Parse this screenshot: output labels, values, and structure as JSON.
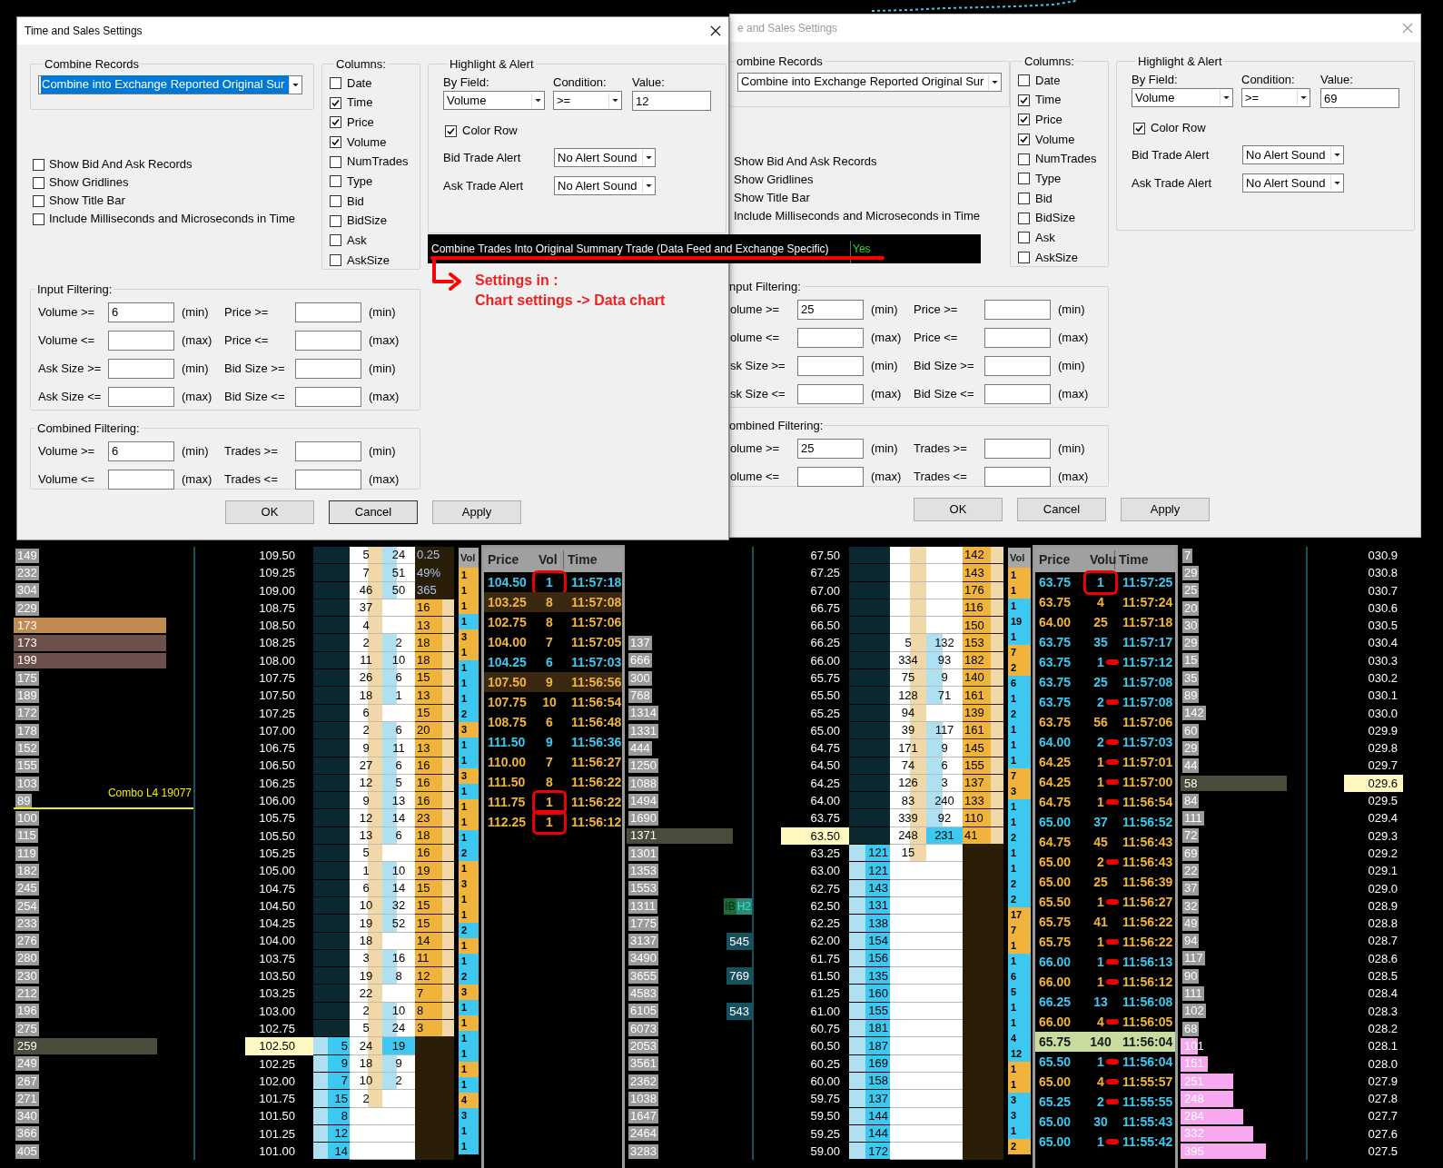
{
  "dialogs": [
    {
      "title": "Time and Sales Settings",
      "active": true,
      "combine_records": {
        "label": "Combine Records",
        "value": "Combine into Exchange Reported Original Sur",
        "focused": true
      },
      "options": [
        {
          "label": "Show Bid And Ask Records",
          "checked": false
        },
        {
          "label": "Show Gridlines",
          "checked": false
        },
        {
          "label": "Show Title Bar",
          "checked": false
        },
        {
          "label": "Include Milliseconds and Microseconds in Time",
          "checked": false
        }
      ],
      "columns": {
        "label": "Columns:",
        "items": [
          {
            "label": "Date",
            "checked": false
          },
          {
            "label": "Time",
            "checked": true
          },
          {
            "label": "Price",
            "checked": true
          },
          {
            "label": "Volume",
            "checked": true
          },
          {
            "label": "NumTrades",
            "checked": false
          },
          {
            "label": "Type",
            "checked": false
          },
          {
            "label": "Bid",
            "checked": false
          },
          {
            "label": "BidSize",
            "checked": false
          },
          {
            "label": "Ask",
            "checked": false
          },
          {
            "label": "AskSize",
            "checked": false
          }
        ]
      },
      "highlight": {
        "label": "Highlight & Alert",
        "by_field_label": "By Field:",
        "by_field": "Volume",
        "condition_label": "Condition:",
        "condition": ">=",
        "value_label": "Value:",
        "value": "12",
        "color_row": {
          "label": "Color Row",
          "checked": true
        },
        "bid_alert_label": "Bid Trade Alert",
        "bid_alert": "No Alert Sound",
        "ask_alert_label": "Ask Trade Alert",
        "ask_alert": "No Alert Sound"
      },
      "input_filtering": {
        "label": "Input Filtering:",
        "rows": [
          [
            {
              "label": "Volume >=",
              "value": "6",
              "unit": "(min)"
            },
            {
              "label": "Price >=",
              "unit": "(min)"
            }
          ],
          [
            {
              "label": "Volume <=",
              "unit": "(max)"
            },
            {
              "label": "Price <=",
              "unit": "(max)"
            }
          ],
          [
            {
              "label": "Ask Size >=",
              "unit": "(min)"
            },
            {
              "label": "Bid Size >=",
              "unit": "(min)"
            }
          ],
          [
            {
              "label": "Ask Size <=",
              "unit": "(max)"
            },
            {
              "label": "Bid Size <=",
              "unit": "(max)"
            }
          ]
        ]
      },
      "combined_filtering": {
        "label": "Combined Filtering:",
        "rows": [
          [
            {
              "label": "Volume >=",
              "value": "6",
              "unit": "(min)"
            },
            {
              "label": "Trades >=",
              "unit": "(min)"
            }
          ],
          [
            {
              "label": "Volume <=",
              "unit": "(max)"
            },
            {
              "label": "Trades <=",
              "unit": "(max)"
            }
          ]
        ]
      },
      "buttons": [
        "OK",
        "Cancel",
        "Apply"
      ]
    },
    {
      "title": "e and Sales Settings",
      "active": false,
      "combine_records": {
        "label": "ombine Records",
        "value": "Combine into Exchange Reported Original Sur",
        "focused": false
      },
      "options": [
        {
          "label": "Show Bid And Ask Records"
        },
        {
          "label": "Show Gridlines"
        },
        {
          "label": "Show Title Bar"
        },
        {
          "label": "Include Milliseconds and Microseconds in Time"
        }
      ],
      "columns": {
        "label": "Columns:",
        "items": [
          {
            "label": "Date",
            "checked": false
          },
          {
            "label": "Time",
            "checked": true
          },
          {
            "label": "Price",
            "checked": true
          },
          {
            "label": "Volume",
            "checked": true
          },
          {
            "label": "NumTrades",
            "checked": false
          },
          {
            "label": "Type",
            "checked": false
          },
          {
            "label": "Bid",
            "checked": false
          },
          {
            "label": "BidSize",
            "checked": false
          },
          {
            "label": "Ask",
            "checked": false
          },
          {
            "label": "AskSize",
            "checked": false
          }
        ]
      },
      "highlight": {
        "label": "Highlight & Alert",
        "by_field_label": "By Field:",
        "by_field": "Volume",
        "condition_label": "Condition:",
        "condition": ">=",
        "value_label": "Value:",
        "value": "69",
        "color_row": {
          "label": "Color Row",
          "checked": true
        },
        "bid_alert_label": "Bid Trade Alert",
        "bid_alert": "No Alert Sound",
        "ask_alert_label": "Ask Trade Alert",
        "ask_alert": "No Alert Sound"
      },
      "input_filtering": {
        "label": "nput Filtering:",
        "rows": [
          [
            {
              "label": "olume >=",
              "value": "25",
              "unit": "(min)"
            },
            {
              "label": "Price >=",
              "unit": "(min)"
            }
          ],
          [
            {
              "label": "olume <=",
              "unit": "(max)"
            },
            {
              "label": "Price <=",
              "unit": "(max)"
            }
          ],
          [
            {
              "label": "sk Size >=",
              "unit": "(min)"
            },
            {
              "label": "Bid Size >=",
              "unit": "(min)"
            }
          ],
          [
            {
              "label": "sk Size <=",
              "unit": "(max)"
            },
            {
              "label": "Bid Size <=",
              "unit": "(max)"
            }
          ]
        ]
      },
      "combined_filtering": {
        "label": "ombined Filtering:",
        "rows": [
          [
            {
              "label": "olume >=",
              "value": "25",
              "unit": "(min)"
            },
            {
              "label": "Trades >=",
              "unit": "(min)"
            }
          ],
          [
            {
              "label": "olume <=",
              "unit": "(max)"
            },
            {
              "label": "Trades <=",
              "unit": "(max)"
            }
          ]
        ]
      },
      "buttons": [
        "OK",
        "Cancel",
        "Apply"
      ]
    }
  ],
  "annotation": {
    "setting": "Combine Trades Into Original Summary Trade (Data Feed and Exchange Specific)",
    "setting_value": "Yes",
    "note": [
      "Settings in :",
      "Chart settings -> Data chart"
    ]
  },
  "ladders": [
    {
      "rows": [
        {
          "profile": "149",
          "price": "109.50",
          "c1": "5",
          "c2": "24",
          "c3": "0.25",
          "kind": "summary"
        },
        {
          "profile": "232",
          "price": "109.25",
          "c1": "7",
          "c2": "51",
          "c3": "49%",
          "kind": "summary"
        },
        {
          "profile": "304",
          "price": "109.00",
          "c1": "46",
          "c2": "50",
          "c3": "365",
          "kind": "summary"
        },
        {
          "profile": "229",
          "price": "108.75",
          "c1": "37",
          "c3": "16",
          "kind": "ask"
        },
        {
          "profile": "173",
          "price": "108.50",
          "c1": "4",
          "c3": "13",
          "kind": "ask",
          "color": "#c08a50",
          "level": 0.85
        },
        {
          "profile": "173",
          "price": "108.25",
          "c1": "2",
          "c2": "2",
          "c3": "18",
          "kind": "ask",
          "color": "#6c504c",
          "level": 0.85
        },
        {
          "profile": "199",
          "price": "108.00",
          "c1": "11",
          "c2": "10",
          "c3": "18",
          "kind": "ask",
          "color": "#6c504c",
          "level": 0.85
        },
        {
          "profile": "175",
          "price": "107.75",
          "c1": "26",
          "c2": "6",
          "c3": "15",
          "kind": "ask"
        },
        {
          "profile": "189",
          "price": "107.50",
          "c1": "18",
          "c2": "1",
          "c3": "13",
          "kind": "ask"
        },
        {
          "profile": "172",
          "price": "107.25",
          "c1": "6",
          "c3": "15",
          "kind": "ask"
        },
        {
          "profile": "178",
          "price": "107.00",
          "c1": "2",
          "c2": "6",
          "c3": "20",
          "kind": "ask"
        },
        {
          "profile": "152",
          "price": "106.75",
          "c1": "9",
          "c2": "11",
          "c3": "13",
          "kind": "ask"
        },
        {
          "profile": "155",
          "price": "106.50",
          "c1": "27",
          "c2": "6",
          "c3": "16",
          "kind": "ask"
        },
        {
          "profile": "103",
          "price": "106.25",
          "c1": "12",
          "c2": "5",
          "c3": "16",
          "kind": "ask"
        },
        {
          "profile": "89",
          "price": "106.00",
          "c1": "9",
          "c2": "13",
          "c3": "16",
          "kind": "ask",
          "line": "Combo L4 19077"
        },
        {
          "profile": "100",
          "price": "105.75",
          "c1": "12",
          "c2": "14",
          "c3": "23",
          "kind": "ask"
        },
        {
          "profile": "115",
          "price": "105.50",
          "c1": "13",
          "c2": "6",
          "c3": "18",
          "kind": "ask"
        },
        {
          "profile": "119",
          "price": "105.25",
          "c1": "5",
          "c3": "16",
          "kind": "ask"
        },
        {
          "profile": "182",
          "price": "105.00",
          "c1": "1",
          "c2": "10",
          "c3": "19",
          "kind": "ask"
        },
        {
          "profile": "245",
          "price": "104.75",
          "c1": "6",
          "c2": "14",
          "c3": "15",
          "kind": "ask"
        },
        {
          "profile": "254",
          "price": "104.50",
          "c1": "10",
          "c2": "32",
          "c3": "15",
          "kind": "ask"
        },
        {
          "profile": "233",
          "price": "104.25",
          "c1": "19",
          "c2": "52",
          "c3": "15",
          "kind": "ask"
        },
        {
          "profile": "276",
          "price": "104.00",
          "c1": "18",
          "c3": "14",
          "kind": "ask"
        },
        {
          "profile": "280",
          "price": "103.75",
          "c1": "3",
          "c2": "16",
          "c3": "11",
          "kind": "ask"
        },
        {
          "profile": "230",
          "price": "103.50",
          "c1": "19",
          "c2": "8",
          "c3": "12",
          "kind": "ask"
        },
        {
          "profile": "212",
          "price": "103.25",
          "c1": "22",
          "c3": "7",
          "kind": "ask"
        },
        {
          "profile": "196",
          "price": "103.00",
          "c1": "2",
          "c2": "10",
          "c3": "8",
          "kind": "ask"
        },
        {
          "profile": "275",
          "price": "102.75",
          "c1": "5",
          "c2": "24",
          "c3": "3",
          "kind": "ask"
        },
        {
          "profile": "259",
          "price": "102.50",
          "bid": "5",
          "c1": "24",
          "c2": "19",
          "kind": "last",
          "color": "#4c4c3c",
          "level": 0.8
        },
        {
          "profile": "249",
          "price": "102.25",
          "bid": "9",
          "c1": "18",
          "c2": "9",
          "kind": "bid"
        },
        {
          "profile": "267",
          "price": "102.00",
          "bid": "7",
          "c1": "10",
          "c2": "2",
          "kind": "bid"
        },
        {
          "profile": "271",
          "price": "101.75",
          "bid": "15",
          "c1": "2",
          "kind": "bid"
        },
        {
          "profile": "340",
          "price": "101.50",
          "bid": "8",
          "kind": "bid"
        },
        {
          "profile": "366",
          "price": "101.25",
          "bid": "12",
          "kind": "bid"
        },
        {
          "profile": "405",
          "price": "101.00",
          "bid": "14",
          "kind": "bid"
        }
      ]
    },
    {
      "rows": [
        {
          "price": "67.50",
          "c3": "142",
          "kind": "ask"
        },
        {
          "price": "67.25",
          "c3": "143",
          "kind": "ask"
        },
        {
          "price": "67.00",
          "c3": "176",
          "kind": "ask"
        },
        {
          "price": "66.75",
          "c3": "116",
          "kind": "ask"
        },
        {
          "price": "66.50",
          "c3": "150",
          "kind": "ask"
        },
        {
          "profile": "137",
          "price": "66.25",
          "c1": "5",
          "c2": "132",
          "c3": "153",
          "kind": "ask"
        },
        {
          "profile": "666",
          "price": "66.00",
          "c1": "334",
          "c2": "93",
          "c3": "182",
          "kind": "ask"
        },
        {
          "profile": "300",
          "price": "65.75",
          "c1": "75",
          "c2": "9",
          "c3": "140",
          "kind": "ask"
        },
        {
          "profile": "768",
          "price": "65.50",
          "c1": "128",
          "c2": "71",
          "c3": "161",
          "kind": "ask"
        },
        {
          "profile": "1314",
          "price": "65.25",
          "c1": "94",
          "c3": "139",
          "kind": "ask"
        },
        {
          "profile": "1331",
          "price": "65.00",
          "c1": "39",
          "c2": "117",
          "c3": "161",
          "kind": "ask"
        },
        {
          "profile": "444",
          "price": "64.75",
          "c1": "171",
          "c2": "9",
          "c3": "145",
          "kind": "ask"
        },
        {
          "profile": "1250",
          "price": "64.50",
          "c1": "74",
          "c2": "6",
          "c3": "155",
          "kind": "ask"
        },
        {
          "profile": "1088",
          "price": "64.25",
          "c1": "126",
          "c2": "3",
          "c3": "137",
          "kind": "ask"
        },
        {
          "profile": "1494",
          "price": "64.00",
          "c1": "83",
          "c2": "240",
          "c3": "133",
          "kind": "ask"
        },
        {
          "profile": "1690",
          "price": "63.75",
          "c1": "339",
          "c2": "92",
          "c3": "110",
          "kind": "ask"
        },
        {
          "profile": "1371",
          "price": "63.50",
          "c1": "248",
          "c2": "231",
          "c3": "41",
          "kind": "last",
          "color": "#4c4c3c",
          "level": 0.85
        },
        {
          "profile": "1301",
          "price": "63.25",
          "bid": "121",
          "c1": "15",
          "kind": "bid"
        },
        {
          "profile": "1353",
          "price": "63.00",
          "bid": "121",
          "kind": "bid"
        },
        {
          "profile": "1553",
          "price": "62.75",
          "bid": "143",
          "kind": "bid"
        },
        {
          "profile": "1311",
          "price": "62.50",
          "bid": "131",
          "kind": "bid",
          "tags": [
            "IB",
            "H2"
          ]
        },
        {
          "profile": "1775",
          "price": "62.25",
          "bid": "138",
          "kind": "bid"
        },
        {
          "profile": "3137",
          "price": "62.00",
          "bid": "154",
          "kind": "bid",
          "hist": "545"
        },
        {
          "profile": "3490",
          "price": "61.75",
          "bid": "156",
          "kind": "bid"
        },
        {
          "profile": "3655",
          "price": "61.50",
          "bid": "135",
          "kind": "bid",
          "hist": "769"
        },
        {
          "profile": "4583",
          "price": "61.25",
          "bid": "160",
          "kind": "bid"
        },
        {
          "profile": "6105",
          "price": "61.00",
          "bid": "155",
          "kind": "bid",
          "hist": "543"
        },
        {
          "profile": "6073",
          "price": "60.75",
          "bid": "181",
          "kind": "bid"
        },
        {
          "profile": "2053",
          "price": "60.50",
          "bid": "187",
          "kind": "bid"
        },
        {
          "profile": "3561",
          "price": "60.25",
          "bid": "169",
          "kind": "bid"
        },
        {
          "profile": "2362",
          "price": "60.00",
          "bid": "158",
          "kind": "bid"
        },
        {
          "profile": "1038",
          "price": "59.75",
          "bid": "137",
          "kind": "bid"
        },
        {
          "profile": "1647",
          "price": "59.50",
          "bid": "144",
          "kind": "bid"
        },
        {
          "profile": "2464",
          "price": "59.25",
          "bid": "144",
          "kind": "bid"
        },
        {
          "profile": "3283",
          "price": "59.00",
          "bid": "172",
          "kind": "bid"
        }
      ]
    },
    {
      "rows": [
        {
          "profile": "7",
          "price": "030.9",
          "kind": "ask"
        },
        {
          "profile": "29",
          "price": "030.8",
          "kind": "ask"
        },
        {
          "profile": "25",
          "price": "030.7",
          "kind": "ask"
        },
        {
          "profile": "20",
          "price": "030.6",
          "kind": "ask"
        },
        {
          "profile": "30",
          "price": "030.5",
          "kind": "ask"
        },
        {
          "profile": "29",
          "price": "030.4",
          "kind": "ask"
        },
        {
          "profile": "15",
          "price": "030.3",
          "kind": "ask"
        },
        {
          "profile": "35",
          "price": "030.2",
          "kind": "ask"
        },
        {
          "profile": "89",
          "price": "030.1",
          "kind": "ask"
        },
        {
          "profile": "142",
          "price": "030.0",
          "kind": "ask"
        },
        {
          "profile": "60",
          "price": "029.9",
          "kind": "ask"
        },
        {
          "profile": "29",
          "price": "029.8",
          "kind": "ask"
        },
        {
          "profile": "44",
          "price": "029.7",
          "kind": "ask"
        },
        {
          "profile": "58",
          "price": "029.6",
          "kind": "last",
          "color": "#4c4c3c",
          "level": 0.85
        },
        {
          "profile": "84",
          "price": "029.5",
          "kind": "bid"
        },
        {
          "profile": "111",
          "price": "029.4",
          "kind": "bid"
        },
        {
          "profile": "72",
          "price": "029.3",
          "kind": "bid"
        },
        {
          "profile": "69",
          "price": "029.2",
          "kind": "bid"
        },
        {
          "profile": "22",
          "price": "029.1",
          "kind": "bid"
        },
        {
          "profile": "37",
          "price": "029.0",
          "kind": "bid"
        },
        {
          "profile": "32",
          "price": "028.9",
          "kind": "bid"
        },
        {
          "profile": "49",
          "price": "028.8",
          "kind": "bid"
        },
        {
          "profile": "94",
          "price": "028.7",
          "kind": "bid"
        },
        {
          "profile": "117",
          "price": "028.6",
          "kind": "bid"
        },
        {
          "profile": "90",
          "price": "028.5",
          "kind": "bid"
        },
        {
          "profile": "111",
          "price": "028.4",
          "kind": "bid"
        },
        {
          "profile": "102",
          "price": "028.3",
          "kind": "bid"
        },
        {
          "profile": "68",
          "price": "028.2",
          "kind": "bid"
        },
        {
          "profile": "101",
          "price": "028.1",
          "kind": "bid",
          "color": "#f8a8f0",
          "level": 0.14
        },
        {
          "profile": "151",
          "price": "028.0",
          "kind": "bid",
          "color": "#f8a8f0",
          "level": 0.22
        },
        {
          "profile": "251",
          "price": "027.9",
          "kind": "bid",
          "color": "#f8a8f0",
          "level": 0.42
        },
        {
          "profile": "248",
          "price": "027.8",
          "kind": "bid",
          "color": "#f8a8f0",
          "level": 0.42
        },
        {
          "profile": "284",
          "price": "027.7",
          "kind": "bid",
          "color": "#f8a8f0",
          "level": 0.5
        },
        {
          "profile": "332",
          "price": "027.6",
          "kind": "bid",
          "color": "#f8a8f0",
          "level": 0.58
        },
        {
          "profile": "395",
          "price": "027.5",
          "kind": "bid",
          "color": "#f8a8f0",
          "level": 0.68
        }
      ]
    }
  ],
  "volume_strips": [
    {
      "header": "Vol",
      "items": [
        {
          "volume": "1",
          "color": "#f0b43c"
        },
        {
          "volume": "1",
          "color": "#f0b43c"
        },
        {
          "volume": "1",
          "color": "#f0b43c"
        },
        {
          "volume": "1",
          "color": "#3cc8f0"
        },
        {
          "volume": "3",
          "color": "#f0b43c"
        },
        {
          "volume": "1",
          "color": "#f0b43c"
        },
        {
          "volume": "1",
          "color": "#3cc8f0"
        },
        {
          "volume": "1",
          "color": "#3cc8f0"
        },
        {
          "volume": "1",
          "color": "#3cc8f0"
        },
        {
          "volume": "2",
          "color": "#3cc8f0"
        },
        {
          "volume": "3",
          "color": "#f0b43c"
        },
        {
          "volume": "1",
          "color": "#3cc8f0"
        },
        {
          "volume": "1",
          "color": "#3cc8f0"
        },
        {
          "volume": "3",
          "color": "#f0b43c"
        },
        {
          "volume": "1",
          "color": "#3cc8f0"
        },
        {
          "volume": "1",
          "color": "#f0b43c"
        },
        {
          "volume": "1",
          "color": "#f0b43c"
        },
        {
          "volume": "1",
          "color": "#3cc8f0"
        },
        {
          "volume": "2",
          "color": "#3cc8f0"
        },
        {
          "volume": "1",
          "color": "#f0b43c"
        },
        {
          "volume": "3",
          "color": "#f0b43c"
        },
        {
          "volume": "1",
          "color": "#f0b43c"
        },
        {
          "volume": "1",
          "color": "#f0b43c"
        },
        {
          "volume": "2",
          "color": "#3cc8f0"
        },
        {
          "volume": "1",
          "color": "#f0b43c"
        },
        {
          "volume": "1",
          "color": "#3cc8f0"
        },
        {
          "volume": "2",
          "color": "#3cc8f0"
        },
        {
          "volume": "3",
          "color": "#f0b43c"
        },
        {
          "volume": "1",
          "color": "#3cc8f0"
        },
        {
          "volume": "1",
          "color": "#f0b43c"
        },
        {
          "volume": "1",
          "color": "#3cc8f0"
        },
        {
          "volume": "1",
          "color": "#3cc8f0"
        },
        {
          "volume": "1",
          "color": "#f0b43c"
        },
        {
          "volume": "1",
          "color": "#3cc8f0"
        },
        {
          "volume": "4",
          "color": "#f0b43c"
        },
        {
          "volume": "3",
          "color": "#3cc8f0"
        },
        {
          "volume": "1",
          "color": "#3cc8f0"
        },
        {
          "volume": "1",
          "color": "#3cc8f0"
        }
      ]
    },
    {
      "header": "Vol",
      "items": [
        {
          "volume": "1",
          "color": "#f0b43c"
        },
        {
          "volume": "1",
          "color": "#f0b43c"
        },
        {
          "volume": "1",
          "color": "#3cc8f0"
        },
        {
          "volume": "19",
          "color": "#3cc8f0"
        },
        {
          "volume": "1",
          "color": "#3cc8f0"
        },
        {
          "volume": "7",
          "color": "#f0b43c"
        },
        {
          "volume": "2",
          "color": "#f0b43c"
        },
        {
          "volume": "6",
          "color": "#3cc8f0"
        },
        {
          "volume": "1",
          "color": "#3cc8f0"
        },
        {
          "volume": "2",
          "color": "#3cc8f0"
        },
        {
          "volume": "1",
          "color": "#3cc8f0"
        },
        {
          "volume": "1",
          "color": "#3cc8f0"
        },
        {
          "volume": "1",
          "color": "#3cc8f0"
        },
        {
          "volume": "7",
          "color": "#f0b43c"
        },
        {
          "volume": "3",
          "color": "#f0b43c"
        },
        {
          "volume": "1",
          "color": "#3cc8f0"
        },
        {
          "volume": "1",
          "color": "#3cc8f0"
        },
        {
          "volume": "2",
          "color": "#3cc8f0"
        },
        {
          "volume": "1",
          "color": "#3cc8f0"
        },
        {
          "volume": "1",
          "color": "#3cc8f0"
        },
        {
          "volume": "2",
          "color": "#3cc8f0"
        },
        {
          "volume": "2",
          "color": "#3cc8f0"
        },
        {
          "volume": "17",
          "color": "#f0b43c"
        },
        {
          "volume": "7",
          "color": "#f0b43c"
        },
        {
          "volume": "1",
          "color": "#f0b43c"
        },
        {
          "volume": "1",
          "color": "#3cc8f0"
        },
        {
          "volume": "6",
          "color": "#3cc8f0"
        },
        {
          "volume": "5",
          "color": "#3cc8f0"
        },
        {
          "volume": "1",
          "color": "#3cc8f0"
        },
        {
          "volume": "1",
          "color": "#3cc8f0"
        },
        {
          "volume": "4",
          "color": "#3cc8f0"
        },
        {
          "volume": "12",
          "color": "#3cc8f0"
        },
        {
          "volume": "1",
          "color": "#f0b43c"
        },
        {
          "volume": "1",
          "color": "#f0b43c"
        },
        {
          "volume": "3",
          "color": "#3cc8f0"
        },
        {
          "volume": "3",
          "color": "#3cc8f0"
        },
        {
          "volume": "1",
          "color": "#3cc8f0"
        },
        {
          "volume": "2",
          "color": "#f0b43c"
        }
      ]
    }
  ],
  "time_and_sales": [
    {
      "columns": [
        "Price",
        "Vol",
        "Time"
      ],
      "rows": [
        {
          "price": "104.50",
          "volume": "1",
          "time": "11:57:18",
          "kind": "buy",
          "highlight": false,
          "boxed": true
        },
        {
          "price": "103.25",
          "volume": "8",
          "time": "11:57:08",
          "kind": "sell",
          "highlight": true
        },
        {
          "price": "102.75",
          "volume": "8",
          "time": "11:57:06",
          "kind": "sell",
          "highlight": false
        },
        {
          "price": "104.00",
          "volume": "7",
          "time": "11:57:05",
          "kind": "sell",
          "highlight": false
        },
        {
          "price": "104.25",
          "volume": "6",
          "time": "11:57:03",
          "kind": "buy",
          "highlight": false
        },
        {
          "price": "107.50",
          "volume": "9",
          "time": "11:56:56",
          "kind": "sell",
          "highlight": true
        },
        {
          "price": "107.75",
          "volume": "10",
          "time": "11:56:54",
          "kind": "sell",
          "highlight": false
        },
        {
          "price": "108.75",
          "volume": "6",
          "time": "11:56:48",
          "kind": "sell",
          "highlight": false
        },
        {
          "price": "111.50",
          "volume": "9",
          "time": "11:56:36",
          "kind": "buy",
          "highlight": false
        },
        {
          "price": "110.00",
          "volume": "7",
          "time": "11:56:27",
          "kind": "sell",
          "highlight": false
        },
        {
          "price": "111.50",
          "volume": "8",
          "time": "11:56:22",
          "kind": "sell",
          "highlight": false
        },
        {
          "price": "111.75",
          "volume": "1",
          "time": "11:56:22",
          "kind": "sell",
          "highlight": false,
          "boxed": true
        },
        {
          "price": "112.25",
          "volume": "1",
          "time": "11:56:12",
          "kind": "sell",
          "highlight": false,
          "boxed": true
        }
      ]
    },
    {
      "columns": [
        "Price",
        "Volu",
        "Time"
      ],
      "rows": [
        {
          "price": "63.75",
          "volume": "1",
          "time": "11:57:25",
          "kind": "buy",
          "boxed": true
        },
        {
          "price": "63.75",
          "volume": "4",
          "time": "11:57:24",
          "kind": "sell"
        },
        {
          "price": "64.00",
          "volume": "25",
          "time": "11:57:18",
          "kind": "sell"
        },
        {
          "price": "63.75",
          "volume": "35",
          "time": "11:57:17",
          "kind": "buy"
        },
        {
          "price": "63.75",
          "volume": "1",
          "time": "11:57:12",
          "kind": "buy",
          "marked": true
        },
        {
          "price": "63.75",
          "volume": "25",
          "time": "11:57:08",
          "kind": "buy"
        },
        {
          "price": "63.75",
          "volume": "2",
          "time": "11:57:08",
          "kind": "buy",
          "marked": true
        },
        {
          "price": "63.75",
          "volume": "56",
          "time": "11:57:06",
          "kind": "sell"
        },
        {
          "price": "64.00",
          "volume": "2",
          "time": "11:57:03",
          "kind": "buy",
          "marked": true
        },
        {
          "price": "64.25",
          "volume": "1",
          "time": "11:57:01",
          "kind": "sell",
          "marked": true
        },
        {
          "price": "64.25",
          "volume": "1",
          "time": "11:57:00",
          "kind": "sell",
          "marked": true
        },
        {
          "price": "64.75",
          "volume": "1",
          "time": "11:56:54",
          "kind": "sell",
          "marked": true
        },
        {
          "price": "65.00",
          "volume": "37",
          "time": "11:56:52",
          "kind": "buy"
        },
        {
          "price": "64.75",
          "volume": "45",
          "time": "11:56:43",
          "kind": "sell"
        },
        {
          "price": "65.00",
          "volume": "2",
          "time": "11:56:43",
          "kind": "sell",
          "marked": true
        },
        {
          "price": "65.00",
          "volume": "25",
          "time": "11:56:39",
          "kind": "sell"
        },
        {
          "price": "65.50",
          "volume": "1",
          "time": "11:56:27",
          "kind": "sell",
          "marked": true
        },
        {
          "price": "65.75",
          "volume": "41",
          "time": "11:56:22",
          "kind": "sell"
        },
        {
          "price": "65.75",
          "volume": "1",
          "time": "11:56:22",
          "kind": "sell",
          "marked": true
        },
        {
          "price": "66.00",
          "volume": "1",
          "time": "11:56:13",
          "kind": "buy",
          "marked": true
        },
        {
          "price": "66.00",
          "volume": "1",
          "time": "11:56:12",
          "kind": "sell",
          "marked": true
        },
        {
          "price": "66.25",
          "volume": "13",
          "time": "11:56:08",
          "kind": "buy"
        },
        {
          "price": "66.00",
          "volume": "4",
          "time": "11:56:05",
          "kind": "sell",
          "marked": true
        },
        {
          "price": "65.75",
          "volume": "140",
          "time": "11:56:04",
          "kind": "alert"
        },
        {
          "price": "65.50",
          "volume": "1",
          "time": "11:56:04",
          "kind": "buy",
          "marked": true
        },
        {
          "price": "65.00",
          "volume": "4",
          "time": "11:55:57",
          "kind": "sell",
          "marked": true
        },
        {
          "price": "65.25",
          "volume": "2",
          "time": "11:55:55",
          "kind": "buy",
          "marked": true
        },
        {
          "price": "65.00",
          "volume": "30",
          "time": "11:55:43",
          "kind": "buy"
        },
        {
          "price": "65.00",
          "volume": "1",
          "time": "11:55:42",
          "kind": "buy",
          "marked": true
        }
      ]
    }
  ]
}
